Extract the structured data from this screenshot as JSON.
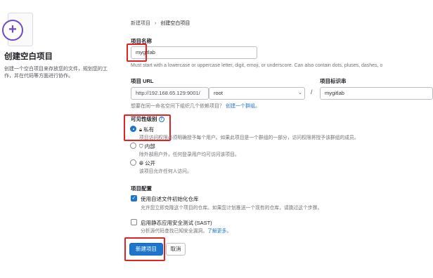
{
  "sidebar": {
    "title": "创建空白项目",
    "description": "创建一个空白项目来存放您的文件，规划您的工作，并在代码等方面进行协作。"
  },
  "breadcrumb": {
    "parent": "新建项目",
    "separator": "›",
    "current": "创建空白项目"
  },
  "project_name": {
    "label": "项目名称",
    "value": "mygitlab",
    "help": "Must start with a lowercase or uppercase letter, digit, emoji, or underscore. Can also contain dots, pluses, dashes, o"
  },
  "project_url": {
    "label": "项目 URL",
    "prefix": "http://192.168.65.129:9001/",
    "namespace": "root",
    "separator": "/",
    "help_text": "想要在同一命名空间下组织几个依赖项目？",
    "help_link": "创建一个群组。"
  },
  "project_slug": {
    "label": "项目标识串",
    "value": "mygitlab"
  },
  "visibility": {
    "label": "可见性级别",
    "options": [
      {
        "icon": "lock-icon",
        "title": "私有",
        "desc": "项目访问权限必须明确授予每个用户。如果此项目是一个群组的一部分，访问权限将授予该群组的成员。",
        "checked": true
      },
      {
        "icon": "shield-icon",
        "title": "内部",
        "desc": "除外部用户外，任何登录用户均可访问该项目。",
        "checked": false
      },
      {
        "icon": "globe-icon",
        "title": "公开",
        "desc": "该项目允许任何人访问。",
        "checked": false
      }
    ]
  },
  "config": {
    "label": "项目配置",
    "readme_title": "使用自述文件初始化仓库",
    "readme_desc": "允许您立即克隆这个项目的仓库。如果您计划推送一个现有的仓库，请跳过这个步骤。",
    "sast_title": "启用静态应用安全测试 (SAST)",
    "sast_desc": "分析源代码查找已知安全漏洞。",
    "sast_link": "了解更多。"
  },
  "actions": {
    "create": "新建项目",
    "cancel": "取消"
  },
  "colors": {
    "accent": "#1f75cb",
    "highlight": "#e02424",
    "brand": "#6e49cb"
  }
}
